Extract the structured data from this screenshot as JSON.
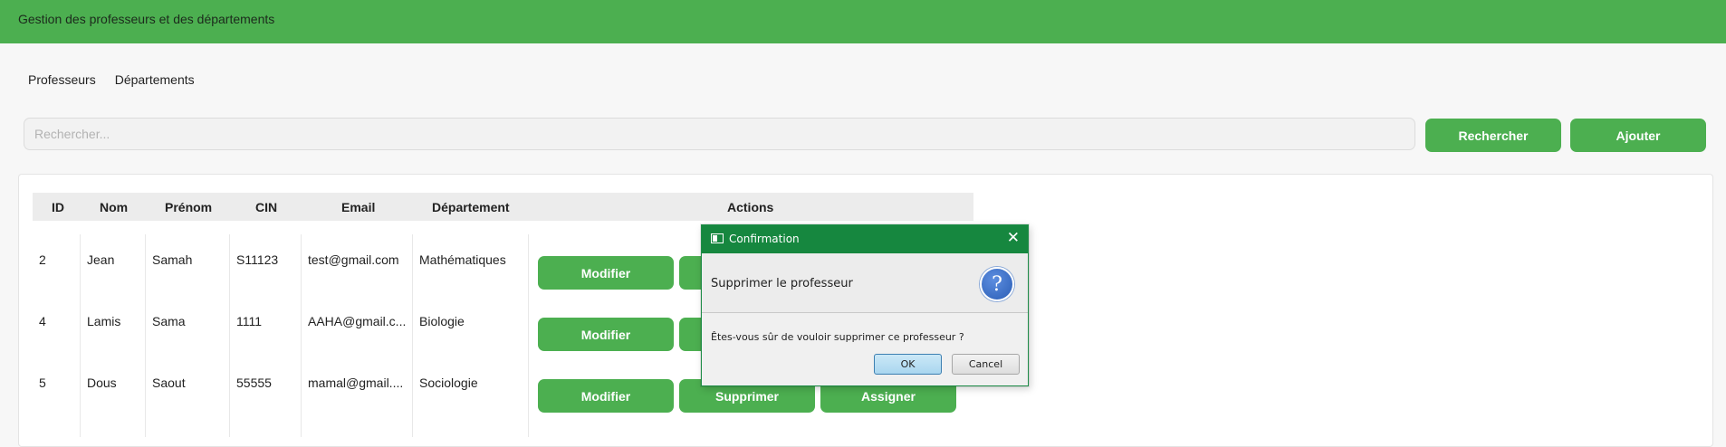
{
  "app": {
    "title": "Gestion des professeurs et des départements"
  },
  "nav": {
    "professeurs": "Professeurs",
    "departements": "Départements"
  },
  "search": {
    "placeholder": "Rechercher...",
    "value": ""
  },
  "toolbar": {
    "search_label": "Rechercher",
    "add_label": "Ajouter"
  },
  "table": {
    "headers": {
      "id": "ID",
      "nom": "Nom",
      "prenom": "Prénom",
      "cin": "CIN",
      "email": "Email",
      "departement": "Département",
      "actions": "Actions"
    },
    "rows": [
      {
        "id": "2",
        "nom": "Jean",
        "prenom": "Samah",
        "cin": "S11123",
        "email": "test@gmail.com",
        "departement": "Mathématiques"
      },
      {
        "id": "4",
        "nom": "Lamis",
        "prenom": "Sama",
        "cin": "1111",
        "email": "AAHA@gmail.c...",
        "departement": "Biologie"
      },
      {
        "id": "5",
        "nom": "Dous",
        "prenom": "Saout",
        "cin": "55555",
        "email": "mamal@gmail....",
        "departement": "Sociologie"
      }
    ],
    "actions": {
      "modify": "Modifier",
      "delete": "Supprimer",
      "assign": "Assigner"
    }
  },
  "dialog": {
    "title": "Confirmation",
    "header": "Supprimer le professeur",
    "message": "Êtes-vous sûr de vouloir supprimer ce professeur ?",
    "ok_label": "OK",
    "cancel_label": "Cancel",
    "close_glyph": "✕",
    "question_glyph": "?"
  },
  "colors": {
    "primary": "#4caf50",
    "dialog_title": "#16873f"
  }
}
